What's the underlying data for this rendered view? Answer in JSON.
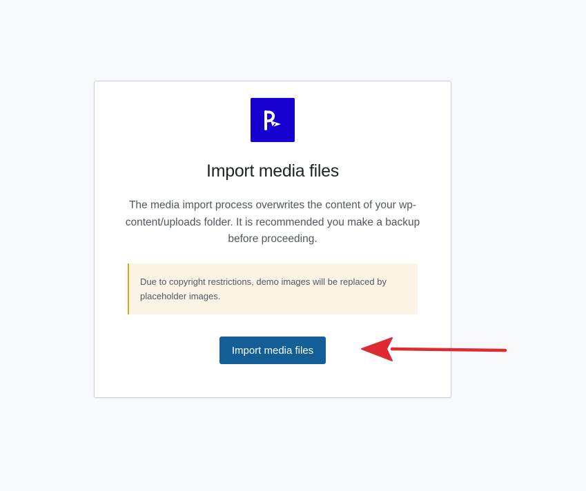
{
  "card": {
    "logo_icon": "paper-plane-p-logo-icon",
    "title": "Import media files",
    "description": "The media import process overwrites the content of your wp-content/uploads folder. It is recommended you make a backup before proceeding.",
    "notice": "Due to copyright restrictions, demo images will be replaced by placeholder images.",
    "import_button_label": "Import media files"
  },
  "annotation": {
    "arrow_icon": "arrow-left-icon",
    "arrow_color": "#e02a32"
  },
  "colors": {
    "logo_bg": "#1500cf",
    "button_bg": "#135e96",
    "notice_bg": "#fcf5e5",
    "notice_border": "#dba617"
  }
}
